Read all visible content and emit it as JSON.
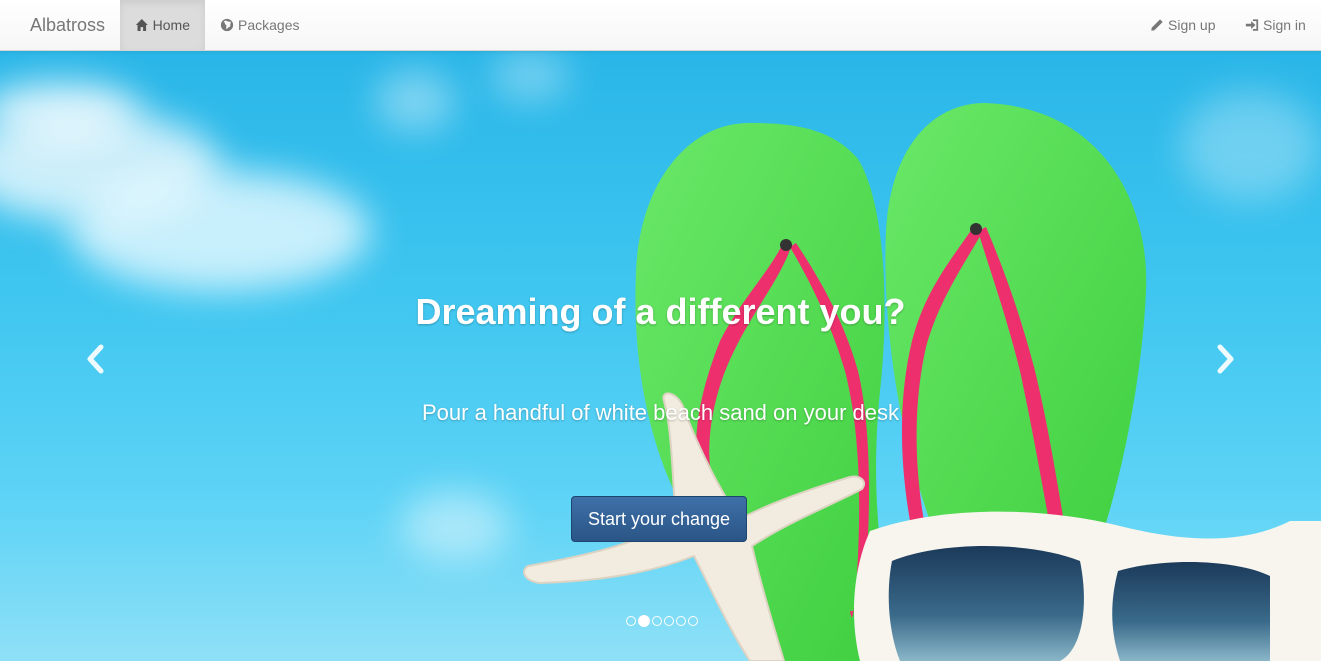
{
  "navbar": {
    "brand": "Albatross",
    "left_items": [
      {
        "label": "Home",
        "icon": "home-icon",
        "active": true
      },
      {
        "label": "Packages",
        "icon": "globe-icon",
        "active": false
      }
    ],
    "right_items": [
      {
        "label": "Sign up",
        "icon": "pencil-icon"
      },
      {
        "label": "Sign in",
        "icon": "log-in-icon"
      }
    ]
  },
  "carousel": {
    "title": "Dreaming of a different you?",
    "subtitle": "Pour a handful of white beach sand on your desk",
    "cta_label": "Start your change",
    "slide_count": 6,
    "active_slide": 2,
    "prev_icon": "chevron-left-icon",
    "next_icon": "chevron-right-icon"
  },
  "colors": {
    "sky": "#3fc6f0",
    "flipflop": "#5ce05a",
    "strap": "#ee2f6e",
    "cta": "#2f5f97"
  }
}
